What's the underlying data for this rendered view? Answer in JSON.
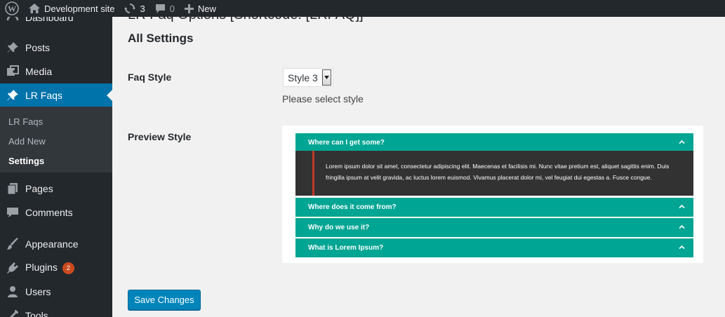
{
  "adminbar": {
    "site_name": "Development site",
    "updates_count": "3",
    "comments_count": "0",
    "new_label": "New"
  },
  "sidebar": {
    "dashboard_label": "Dashboard",
    "items": [
      {
        "label": "Posts",
        "icon": "pin-icon"
      },
      {
        "label": "Media",
        "icon": "media-icon"
      },
      {
        "label": "LR Faqs",
        "icon": "pin-icon",
        "active": true
      }
    ],
    "submenu": [
      {
        "label": "LR Faqs"
      },
      {
        "label": "Add New"
      },
      {
        "label": "Settings",
        "current": true
      }
    ],
    "items_after": [
      {
        "label": "Pages",
        "icon": "pages-icon"
      },
      {
        "label": "Comments",
        "icon": "comments-icon"
      },
      {
        "label": "Appearance",
        "icon": "brush-icon"
      },
      {
        "label": "Plugins",
        "icon": "plugin-icon",
        "badge": "2"
      },
      {
        "label": "Users",
        "icon": "user-icon"
      },
      {
        "label": "Tools",
        "icon": "wrench-icon"
      }
    ]
  },
  "page": {
    "heading": "LR Faq Options [Shortcode: [LRFAQ]]",
    "section_title": "All Settings",
    "faq_style_label": "Faq Style",
    "faq_style_value": "Style 3",
    "faq_style_description": "Please select style",
    "preview_label": "Preview Style",
    "save_button": "Save Changes"
  },
  "preview": {
    "questions": [
      "Where can I get some?",
      "Where does it come from?",
      "Why do we use it?",
      "What is Lorem Ipsum?"
    ],
    "answer": "Lorem ipsum dolor sit amet, consectetur adipiscing elit. Maecenas et facilisis mi. Nunc vitae pretium est, aliquet sagittis enim. Duis fringilla ipsum at velit gravida, ac luctus lorem euismod. Vivamus placerat dolor mi, vel feugiat dui egestas a. Fusce congue."
  },
  "colors": {
    "admin_dark": "#23282d",
    "submenu_bg": "#32373c",
    "active_blue": "#0073aa",
    "faq_teal": "#00a593",
    "faq_answer_bg": "#323232",
    "faq_accent_red": "#c0392b",
    "button_blue": "#0085ba",
    "badge_orange": "#ca4a1f"
  }
}
